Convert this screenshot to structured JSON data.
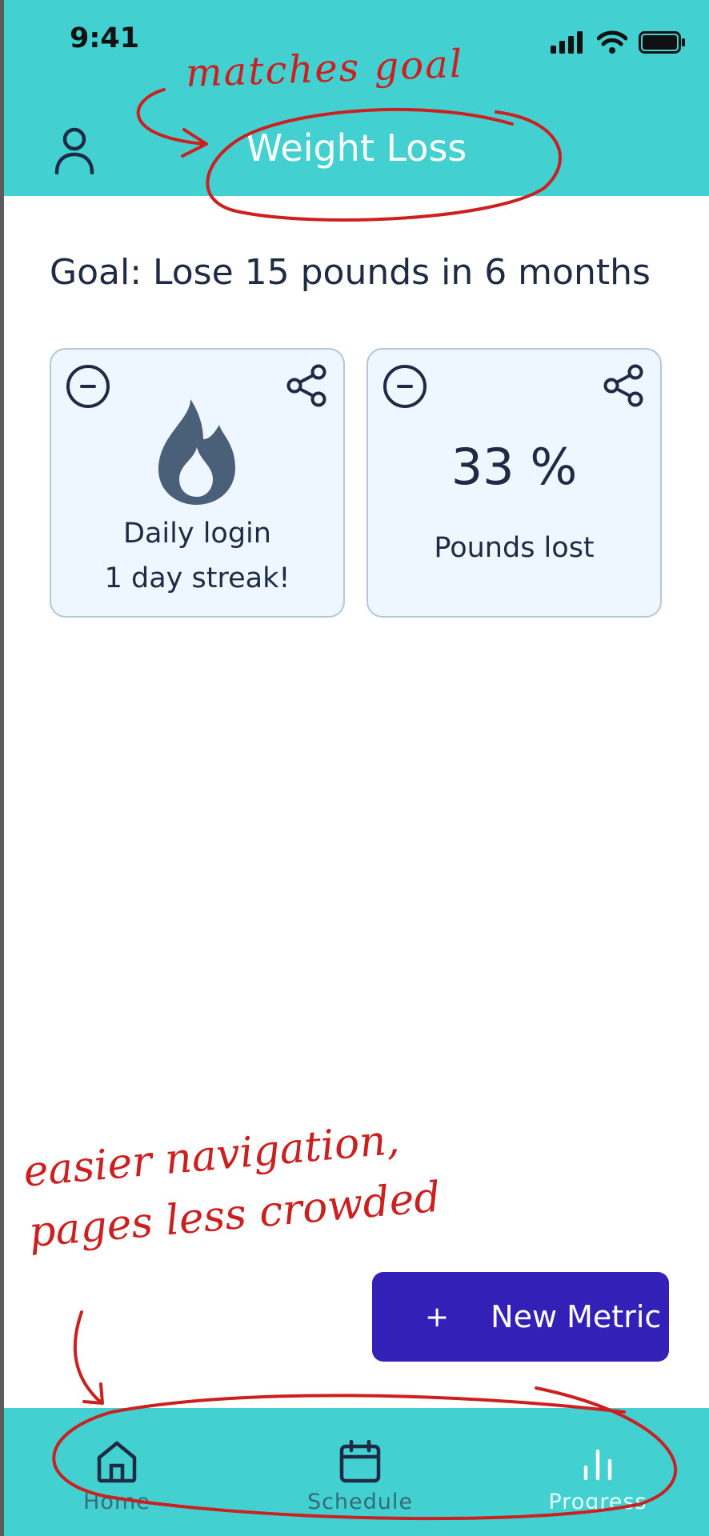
{
  "status": {
    "time": "9:41"
  },
  "header": {
    "title": "Weight Loss"
  },
  "goal": {
    "text": "Goal: Lose 15 pounds in 6 months"
  },
  "cards": [
    {
      "line1": "Daily login",
      "line2": "1 day streak!"
    },
    {
      "value": "33 %",
      "label": "Pounds lost"
    }
  ],
  "new_metric": {
    "plus": "+",
    "label": "New Metric"
  },
  "nav": {
    "home": "Home",
    "schedule": "Schedule",
    "progress": "Progress"
  },
  "annotations": {
    "top": "matches goal",
    "bottom_line1": "easier navigation,",
    "bottom_line2": "pages less crowded"
  },
  "colors": {
    "header": "#42d0d1",
    "button": "#3320b6",
    "annotation": "#cc1f1f",
    "card_bg": "#eef6ff"
  }
}
